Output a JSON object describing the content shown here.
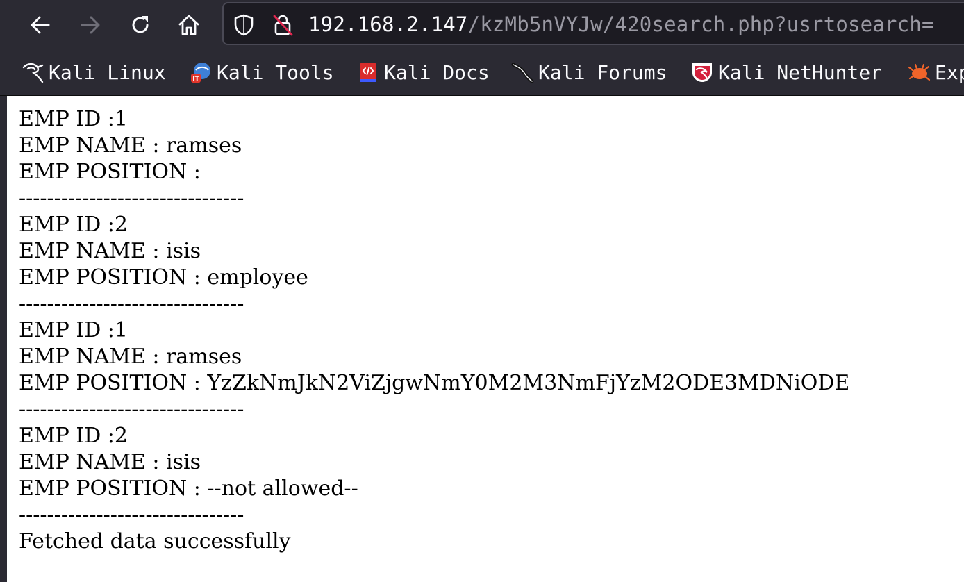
{
  "browser": {
    "url_host": "192.168.2.147",
    "url_path": "/kzMb5nVYJw/420search.php?usrtosearch=",
    "bookmarks": [
      {
        "label": "Kali Linux",
        "icon": "kali-dragon-icon"
      },
      {
        "label": "Kali Tools",
        "icon": "kali-tools-icon"
      },
      {
        "label": "Kali Docs",
        "icon": "kali-docs-icon"
      },
      {
        "label": "Kali Forums",
        "icon": "kali-forums-icon"
      },
      {
        "label": "Kali NetHunter",
        "icon": "kali-nethunter-icon"
      },
      {
        "label": "Exp",
        "icon": "exploit-db-icon"
      }
    ],
    "colors": {
      "toolbar": "#2b2a33",
      "url_field": "#1c1b22",
      "text": "#fbfbfe",
      "dim_text": "#9a99a3"
    }
  },
  "page": {
    "records": [
      {
        "id_line": "EMP ID :1",
        "name_line": "EMP NAME : ramses",
        "position_line": "EMP POSITION : ",
        "separator": "--------------------------------"
      },
      {
        "id_line": "EMP ID :2",
        "name_line": "EMP NAME : isis",
        "position_line": "EMP POSITION : employee",
        "separator": "--------------------------------"
      },
      {
        "id_line": "EMP ID :1",
        "name_line": "EMP NAME : ramses",
        "position_line": "EMP POSITION : YzZkNmJkN2ViZjgwNmY0M2M3NmFjYzM2ODE3MDNiODE",
        "separator": "--------------------------------"
      },
      {
        "id_line": "EMP ID :2",
        "name_line": "EMP NAME : isis",
        "position_line": "EMP POSITION : --not allowed--",
        "separator": "--------------------------------"
      }
    ],
    "status": "Fetched data successfully"
  }
}
